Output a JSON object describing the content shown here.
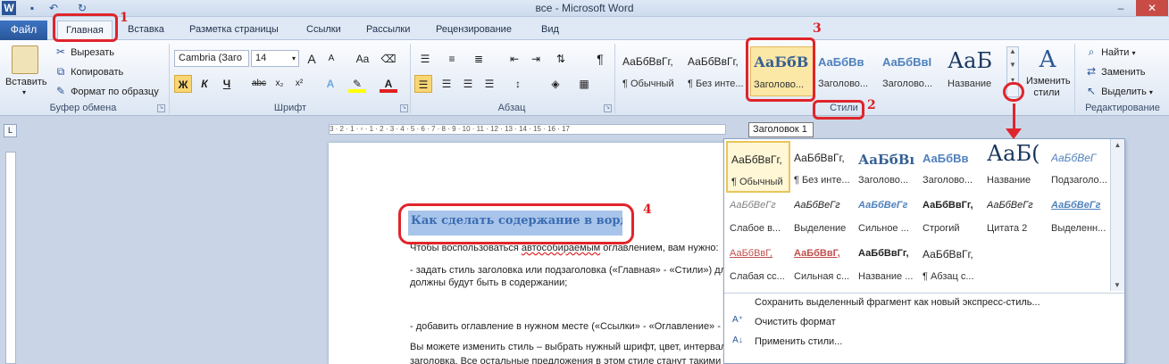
{
  "window": {
    "title": "все - Microsoft Word"
  },
  "qat": {
    "icons": [
      "word-icon",
      "save-icon",
      "undo-icon",
      "redo-icon"
    ]
  },
  "tabs": [
    {
      "label": "Файл"
    },
    {
      "label": "Главная"
    },
    {
      "label": "Вставка"
    },
    {
      "label": "Разметка страницы"
    },
    {
      "label": "Ссылки"
    },
    {
      "label": "Рассылки"
    },
    {
      "label": "Рецензирование"
    },
    {
      "label": "Вид"
    }
  ],
  "clipboard": {
    "paste_label": "Вставить",
    "cut_label": "Вырезать",
    "copy_label": "Копировать",
    "format_painter_label": "Формат по образцу",
    "group_label": "Буфер обмена"
  },
  "font": {
    "family": "Cambria (Заго",
    "size": "14",
    "grow": "A",
    "shrink": "A",
    "case": "Aa",
    "bold": "Ж",
    "italic": "К",
    "underline": "Ч",
    "strike": "abc",
    "sub": "x₂",
    "sup": "x²",
    "color_letter": "A",
    "group_label": "Шрифт"
  },
  "paragraph": {
    "group_label": "Абзац",
    "pilcrow": "¶"
  },
  "styles_ribbon": [
    {
      "sample": "АаБбВвГг,",
      "caption": "¶ Обычный"
    },
    {
      "sample": "АаБбВвГг,",
      "caption": "¶ Без инте..."
    },
    {
      "sample": "АаБбВ",
      "caption": "Заголово..."
    },
    {
      "sample": "АаБбВв",
      "caption": "Заголово..."
    },
    {
      "sample": "АаБбВвI",
      "caption": "Заголово..."
    },
    {
      "sample": "АаБ",
      "caption": "Название"
    }
  ],
  "styles": {
    "change_label_1": "Изменить",
    "change_label_2": "стили",
    "group_label": "Стили"
  },
  "editing": {
    "find_label": "Найти",
    "replace_label": "Заменить",
    "select_label": "Выделить",
    "group_label": "Редактирование"
  },
  "tooltip": "Заголовок 1",
  "ruler_text": "3 · 2 · 1 · ▫ · 1 · 2 · 3 · 4 · 5 · 6 · 7 · 8 · 9 · 10 · 11 · 12 · 13 · 14 · 15 · 16 · 17",
  "document": {
    "heading": "Как сделать содержание в ворде",
    "p1_start": "Чтобы воспользоваться ",
    "p1_underlined": "автособираемым",
    "p1_end": " оглавлением, вам нужно:",
    "p2": "- задать стиль заголовка или подзаголовка («Главная» - «Стили») для",
    "p3": "должны будут быть в содержании;",
    "p4": "- добавить оглавление в нужном месте («Ссылки» - «Оглавление» - од",
    "p5": "Вы можете изменить стиль – выбрать нужный шрифт, цвет, интервал,",
    "p6": "заголовка. Все остальные предложения в этом стиле станут такими ж"
  },
  "styles_panel": [
    {
      "sample": "АаБбВвГг,",
      "caption": "¶ Обычный"
    },
    {
      "sample": "АаБбВвГг,",
      "caption": "¶ Без инте..."
    },
    {
      "sample": "АаБбВı",
      "caption": "Заголово..."
    },
    {
      "sample": "АаБбВв",
      "caption": "Заголово..."
    },
    {
      "sample": "АаБ(",
      "caption": "Название"
    },
    {
      "sample": "АаБбВеГ",
      "caption": "Подзаголо..."
    },
    {
      "sample": "АаБбВеГг",
      "caption": "Слабое в..."
    },
    {
      "sample": "АаБбВеГг",
      "caption": "Выделение"
    },
    {
      "sample": "АаБбВеГг",
      "caption": "Сильное ..."
    },
    {
      "sample": "АаБбВвГг,",
      "caption": "Строгий"
    },
    {
      "sample": "АаБбВеГг",
      "caption": "Цитата 2"
    },
    {
      "sample": "АаБбВеГг",
      "caption": "Выделенн..."
    },
    {
      "sample": "АаБбВвГ,",
      "caption": "Слабая сс..."
    },
    {
      "sample": "АаБбВвГ,",
      "caption": "Сильная с..."
    },
    {
      "sample": "АаБбВвГг,",
      "caption": "Название ..."
    },
    {
      "sample": "АаБбВвГг,",
      "caption": "¶ Абзац с..."
    }
  ],
  "panel_menu": {
    "save_selection": "Сохранить выделенный фрагмент как новый экспресс-стиль...",
    "clear_format": "Очистить формат",
    "apply_styles": "Применить стили..."
  },
  "annotations": [
    "1",
    "2",
    "3",
    "4"
  ],
  "colors": {
    "annotation": "#e0242b",
    "file_tab": "#2a5699",
    "heading_text": "#3a6cb3",
    "selection": "#a8c4ea"
  }
}
